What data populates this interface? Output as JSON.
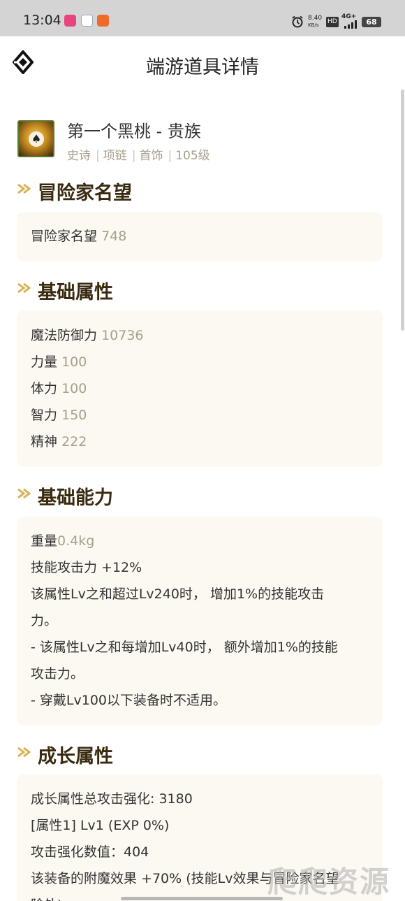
{
  "status_bar": {
    "time": "13:04",
    "speed_value": "8.40",
    "speed_unit": "KB/s",
    "hd": "HD",
    "network": "4G+",
    "battery": "68"
  },
  "header": {
    "title": "端游道具详情"
  },
  "item": {
    "name": "第一个黑桃 - 贵族",
    "tags": [
      "史诗",
      "项链",
      "首饰",
      "105级"
    ]
  },
  "sections": {
    "reputation": {
      "title": "冒险家名望",
      "rows": [
        {
          "label": "冒险家名望",
          "value": "748"
        }
      ]
    },
    "base_attributes": {
      "title": "基础属性",
      "rows": [
        {
          "label": "魔法防御力",
          "value": "10736"
        },
        {
          "label": "力量",
          "value": "100"
        },
        {
          "label": "体力",
          "value": "100"
        },
        {
          "label": "智力",
          "value": "150"
        },
        {
          "label": "精神",
          "value": "222"
        }
      ]
    },
    "base_abilities": {
      "title": "基础能力",
      "weight_label": "重量",
      "weight_value": "0.4kg",
      "lines": [
        "技能攻击力 +12%",
        "该属性Lv之和超过Lv240时， 增加1%的技能攻击",
        "力。",
        "- 该属性Lv之和每增加Lv40时， 额外增加1%的技能",
        "攻击力。",
        "- 穿戴Lv100以下装备时不适用。"
      ]
    },
    "growth_attributes": {
      "title": "成长属性",
      "lines": [
        "成长属性总攻击强化: 3180",
        "[属性1] Lv1 (EXP 0%)",
        "攻击强化数值：404",
        "该装备的附魔效果 +70% (技能Lv效果与冒险家名望",
        "除外)"
      ]
    }
  },
  "watermark": "爬爬资源",
  "colors": {
    "accent_gold": "#d8b45a",
    "heading_brown": "#3a2b10",
    "value_grey": "#a89f8c",
    "card_bg": "#fcf9f3"
  }
}
